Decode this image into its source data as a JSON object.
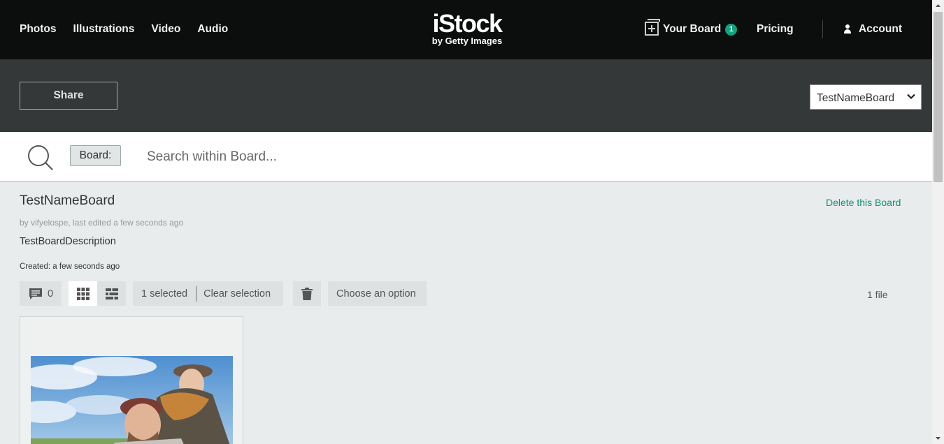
{
  "nav": {
    "links": [
      "Photos",
      "Illustrations",
      "Video",
      "Audio"
    ],
    "logo_main": "iStock",
    "logo_sub": "by Getty Images",
    "your_board_label": "Your Board",
    "board_count": "1",
    "pricing_label": "Pricing",
    "account_label": "Account"
  },
  "boardbar": {
    "share_label": "Share",
    "selected_board": "TestNameBoard"
  },
  "search": {
    "scope_tag": "Board:",
    "placeholder": "Search within Board..."
  },
  "board": {
    "title": "TestNameBoard",
    "delete_label": "Delete this Board",
    "meta": "by vifyelospe, last edited a few seconds ago",
    "description": "TestBoardDescription",
    "created": "Created: a few seconds ago"
  },
  "toolbar": {
    "comment_count": "0",
    "selected_text": "1 selected",
    "clear_label": "Clear selection",
    "option_label": "Choose an option",
    "file_count": "1 file"
  },
  "colors": {
    "nav_bg": "#0c0d0d",
    "boardbar_bg": "#353838",
    "accent": "#0fa37f",
    "link": "#0a9673",
    "page_bg": "#e8eced"
  }
}
